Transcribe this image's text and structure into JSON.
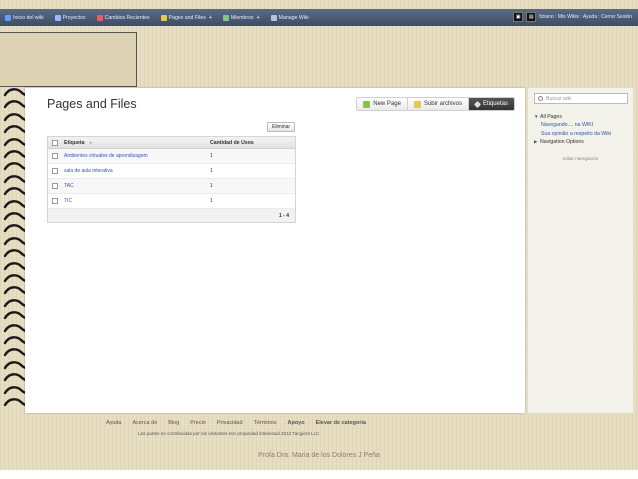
{
  "nav": {
    "items": [
      {
        "label": "Inicio del wiki",
        "color": "#5fa0ff",
        "plus": ""
      },
      {
        "label": "Proyectos",
        "color": "#9ab6ff",
        "plus": ""
      },
      {
        "label": "Cambios Recientes",
        "color": "#e06060",
        "plus": ""
      },
      {
        "label": "Pages and Files",
        "color": "#e6c850",
        "plus": "+"
      },
      {
        "label": "Miembros",
        "color": "#7fc97f",
        "plus": "+"
      },
      {
        "label": "Manage Wiki",
        "color": "#b8c4d8",
        "plus": ""
      }
    ],
    "right_links": "fiziano : Mis Wikis : Ayuda : Cerrar Sesión"
  },
  "page": {
    "title": "Pages and Files",
    "actions": {
      "new_page": "New Page",
      "upload": "Subir archivos",
      "tags": "Etiquetas"
    },
    "delete_button": "Eliminar",
    "table": {
      "headers": {
        "tag": "Etiqueta",
        "sort": "▼",
        "uses": "Cantidad de Usos"
      },
      "rows": [
        {
          "tag": "Ambientes virtuales de aprendizagem",
          "uses": "1"
        },
        {
          "tag": "sala de aula interativa",
          "uses": "1"
        },
        {
          "tag": "TAC",
          "uses": "1"
        },
        {
          "tag": "TIC",
          "uses": "1"
        }
      ],
      "pagination": "1 - 4"
    }
  },
  "sidebar": {
    "search_placeholder": "Buscar wiki",
    "all_pages": "All Pages",
    "link1": "Navegando.... na WIKI",
    "link2": "Sua opinião a respeito da Wiki",
    "nav_options": "Navigation Options",
    "edit_nav": "editar navegación"
  },
  "footer": {
    "links": [
      "Ayuda",
      "Acerca de",
      "Blog",
      "Precio",
      "Privacidad",
      "Términos"
    ],
    "bold_links": [
      "Apoyo",
      "Elevar de categoría"
    ],
    "legal": "Las partes no contribuidas por los visitantes son propiedad intelectual 2012 Tangient LLC"
  },
  "caption": "Profa Dra. Maria de los Dolores J Peña"
}
